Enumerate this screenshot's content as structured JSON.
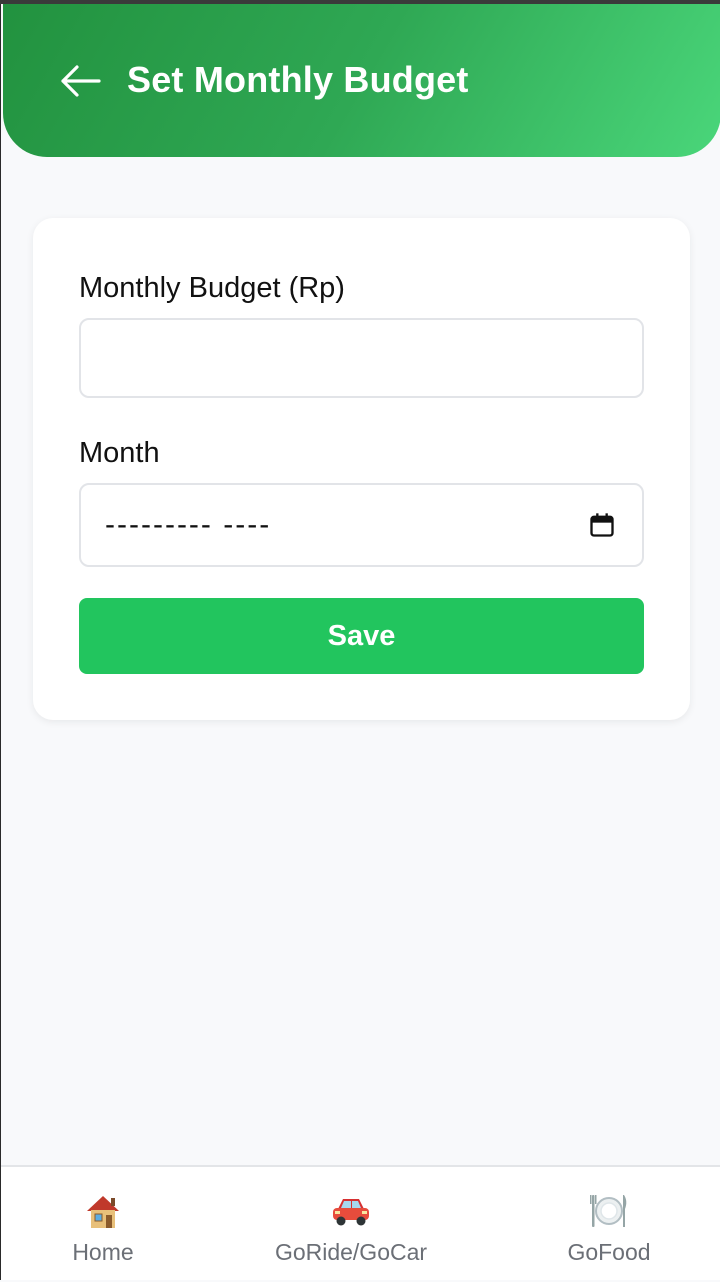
{
  "header": {
    "title": "Set Monthly Budget",
    "background_color": "#2fa854"
  },
  "form": {
    "budget_label": "Monthly Budget (Rp)",
    "budget_value": "",
    "budget_placeholder": "",
    "month_label": "Month",
    "month_value": "--------- ----",
    "save_label": "Save",
    "save_color": "#22c55e"
  },
  "bottom_nav": {
    "items": [
      {
        "label": "Home",
        "icon": "house-icon"
      },
      {
        "label": "GoRide/GoCar",
        "icon": "car-icon"
      },
      {
        "label": "GoFood",
        "icon": "plate-cutlery-icon"
      }
    ]
  }
}
